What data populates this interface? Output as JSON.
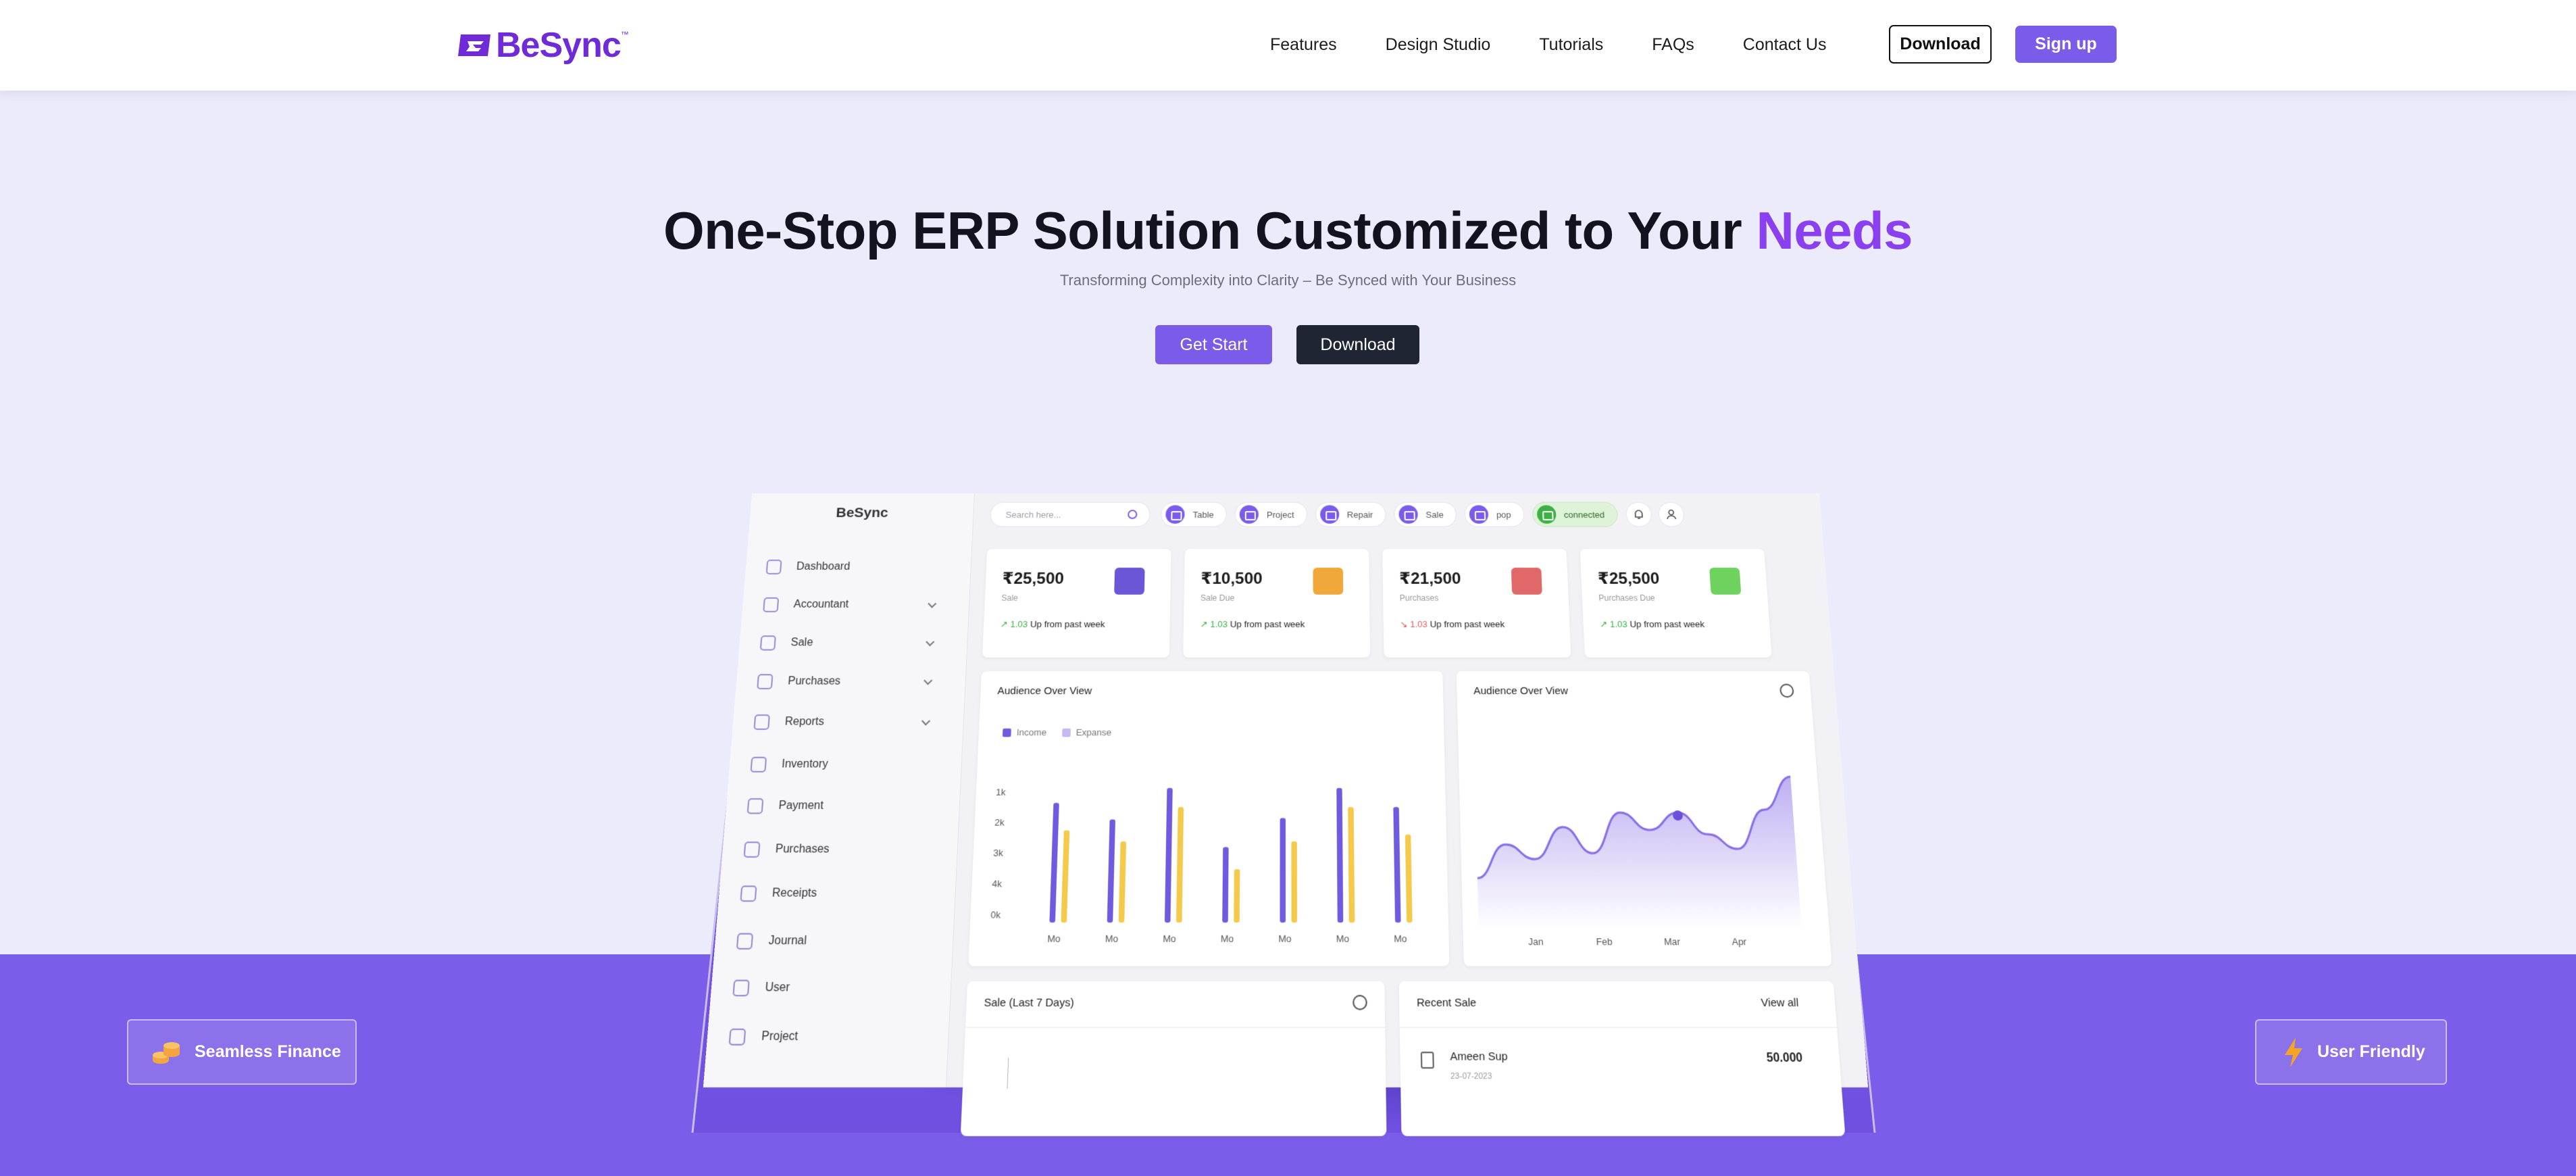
{
  "nav": {
    "logo_text": "BeSync",
    "logo_tm": "™",
    "links": [
      "Features",
      "Design Studio",
      "Tutorials",
      "FAQs",
      "Contact Us"
    ],
    "download": "Download",
    "signup": "Sign up"
  },
  "hero": {
    "title_main": "One-Stop ERP Solution Customized to Your ",
    "title_accent": "Needs",
    "subtitle": "Transforming Complexity into Clarity – Be Synced with Your Business",
    "get_start": "Get Start",
    "download": "Download"
  },
  "features": {
    "left": "Seamless Finance",
    "right": "User Friendly"
  },
  "dashboard": {
    "logo": "BeSync",
    "sidebar": [
      {
        "label": "Dashboard",
        "chevron": false
      },
      {
        "label": "Accountant",
        "chevron": true
      },
      {
        "label": "Sale",
        "chevron": true
      },
      {
        "label": "Purchases",
        "chevron": true
      },
      {
        "label": "Reports",
        "chevron": true
      },
      {
        "label": "Inventory",
        "chevron": false
      },
      {
        "label": "Payment",
        "chevron": false
      },
      {
        "label": "Purchases",
        "chevron": false
      },
      {
        "label": "Receipts",
        "chevron": false
      },
      {
        "label": "Journal",
        "chevron": false
      },
      {
        "label": "User",
        "chevron": false
      },
      {
        "label": "Project",
        "chevron": false
      }
    ],
    "search_placeholder": "Search here...",
    "chips": [
      "Table",
      "Project",
      "Repair",
      "Sale",
      "pop"
    ],
    "connected": "connected",
    "cards": [
      {
        "amount": "₹25,500",
        "label": "Sale",
        "pct": "1.03",
        "trend": "Up from past week",
        "color": "#6b56d6",
        "up": true
      },
      {
        "amount": "₹10,500",
        "label": "Sale Due",
        "pct": "1.03",
        "trend": "Up from past week",
        "color": "#f0a83a",
        "up": true
      },
      {
        "amount": "₹21,500",
        "label": "Purchases",
        "pct": "1.03",
        "trend": "Up from past week",
        "color": "#e06868",
        "up": false
      },
      {
        "amount": "₹25,500",
        "label": "Purchases Due",
        "pct": "1.03",
        "trend": "Up from past week",
        "color": "#6fd15e",
        "up": true
      }
    ],
    "bar_panel": {
      "title": "Audience Over View",
      "legend_income": "Income",
      "legend_expense": "Expanse"
    },
    "area_panel": {
      "title": "Audience Over View"
    },
    "sale_panel": {
      "title": "Sale  (Last 7 Days)"
    },
    "recent_panel": {
      "title": "Recent Sale",
      "view_all": "View all",
      "name": "Ameen Sup",
      "date": "23-07-2023",
      "amount": "50.000"
    }
  },
  "chart_data": [
    {
      "type": "bar",
      "title": "Audience Over View",
      "categories": [
        "Mo",
        "Mo",
        "Mo",
        "Mo",
        "Mo",
        "Mo",
        "Mo"
      ],
      "yticks": [
        "1k",
        "2k",
        "3k",
        "4k",
        "0k"
      ],
      "series": [
        {
          "name": "Income",
          "values": [
            0.86,
            0.74,
            0.97,
            0.54,
            0.75,
            0.97,
            0.83
          ]
        },
        {
          "name": "Expanse",
          "values": [
            0.66,
            0.58,
            0.83,
            0.38,
            0.58,
            0.83,
            0.63
          ]
        }
      ],
      "colors": [
        "#6f5ae0",
        "#f5c94a"
      ]
    },
    {
      "type": "area",
      "title": "Audience Over View",
      "categories": [
        "Jan",
        "Feb",
        "Mar",
        "Apr"
      ],
      "values": [
        0.15,
        0.38,
        0.28,
        0.5,
        0.32,
        0.6,
        0.48,
        0.6,
        0.45,
        0.35,
        0.62,
        0.85
      ],
      "color": "#8a6ee8"
    }
  ]
}
